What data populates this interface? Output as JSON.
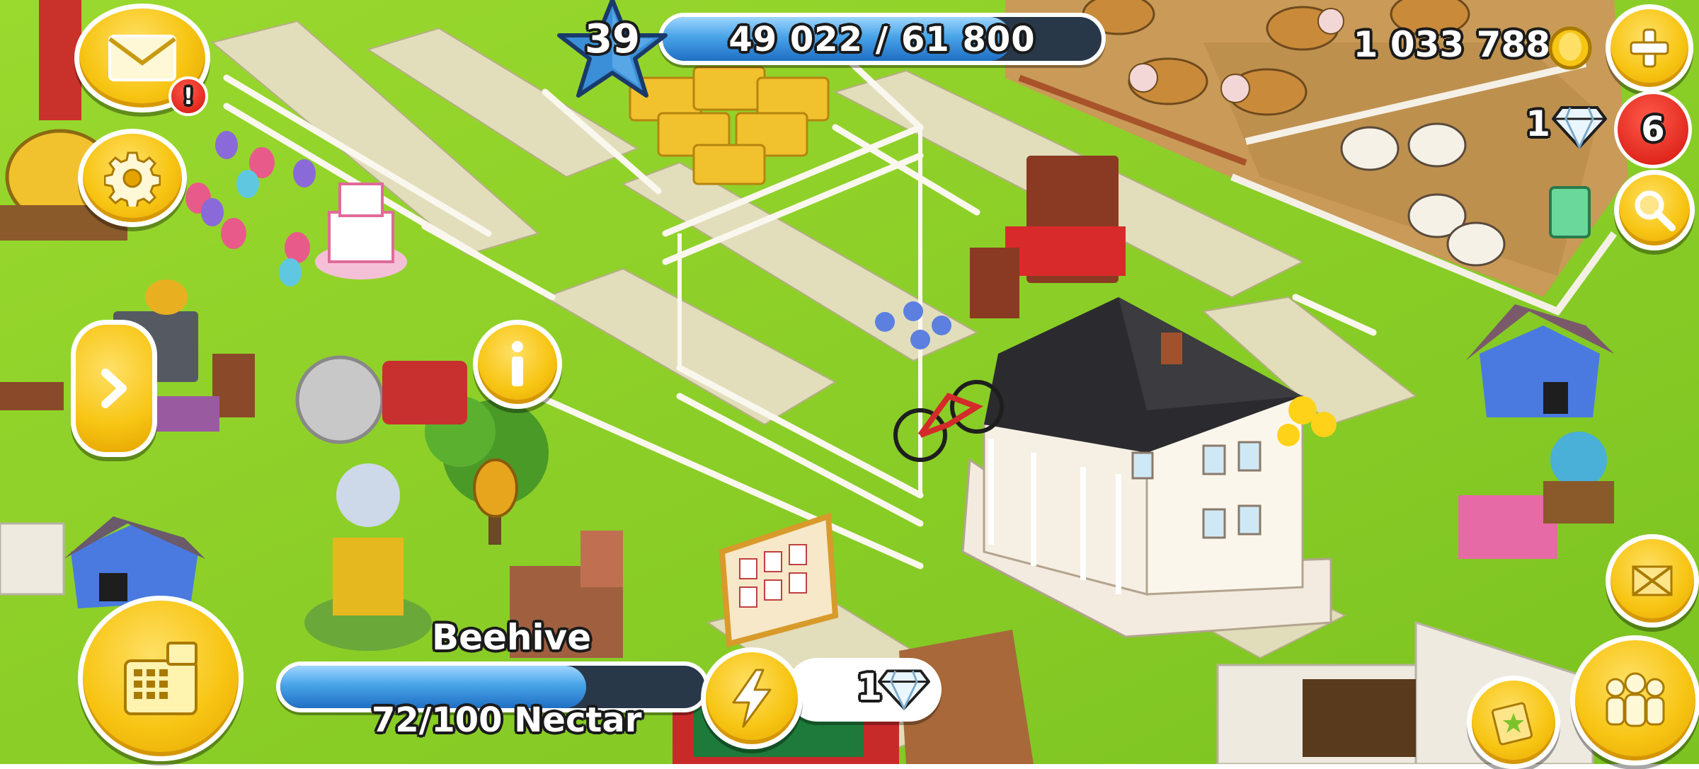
{
  "player": {
    "level": "39",
    "xp_text": "49 022 / 61 800",
    "xp_progress": 0.7932
  },
  "currency": {
    "coins": "1 033 788",
    "diamonds": "1",
    "notifications_count": "6"
  },
  "mail": {
    "alert_mark": "!"
  },
  "selected_building": {
    "name": "Beehive",
    "progress_text": "72/100 Nectar",
    "progress": 0.72,
    "speedup_cost": "1"
  },
  "icons": {
    "mail": "envelope-icon",
    "settings": "gear-icon",
    "expand": "chevron-right-icon",
    "info": "info-icon",
    "add_coins": "plus-icon",
    "search": "magnifier-icon",
    "shop": "cash-register-icon",
    "speedup": "lightning-icon",
    "diamond": "diamond-icon",
    "coin": "coin-icon",
    "friends": "friends-icon",
    "expansion": "expand-arrows-icon",
    "collection": "scrapbook-icon"
  },
  "colors": {
    "grass": "#8fd42a",
    "button_yellow": "#f7c514",
    "alert_red": "#d4140c",
    "bar_blue": "#49a4e8",
    "bar_track": "#283848",
    "star_blue": "#3a8fd8"
  }
}
